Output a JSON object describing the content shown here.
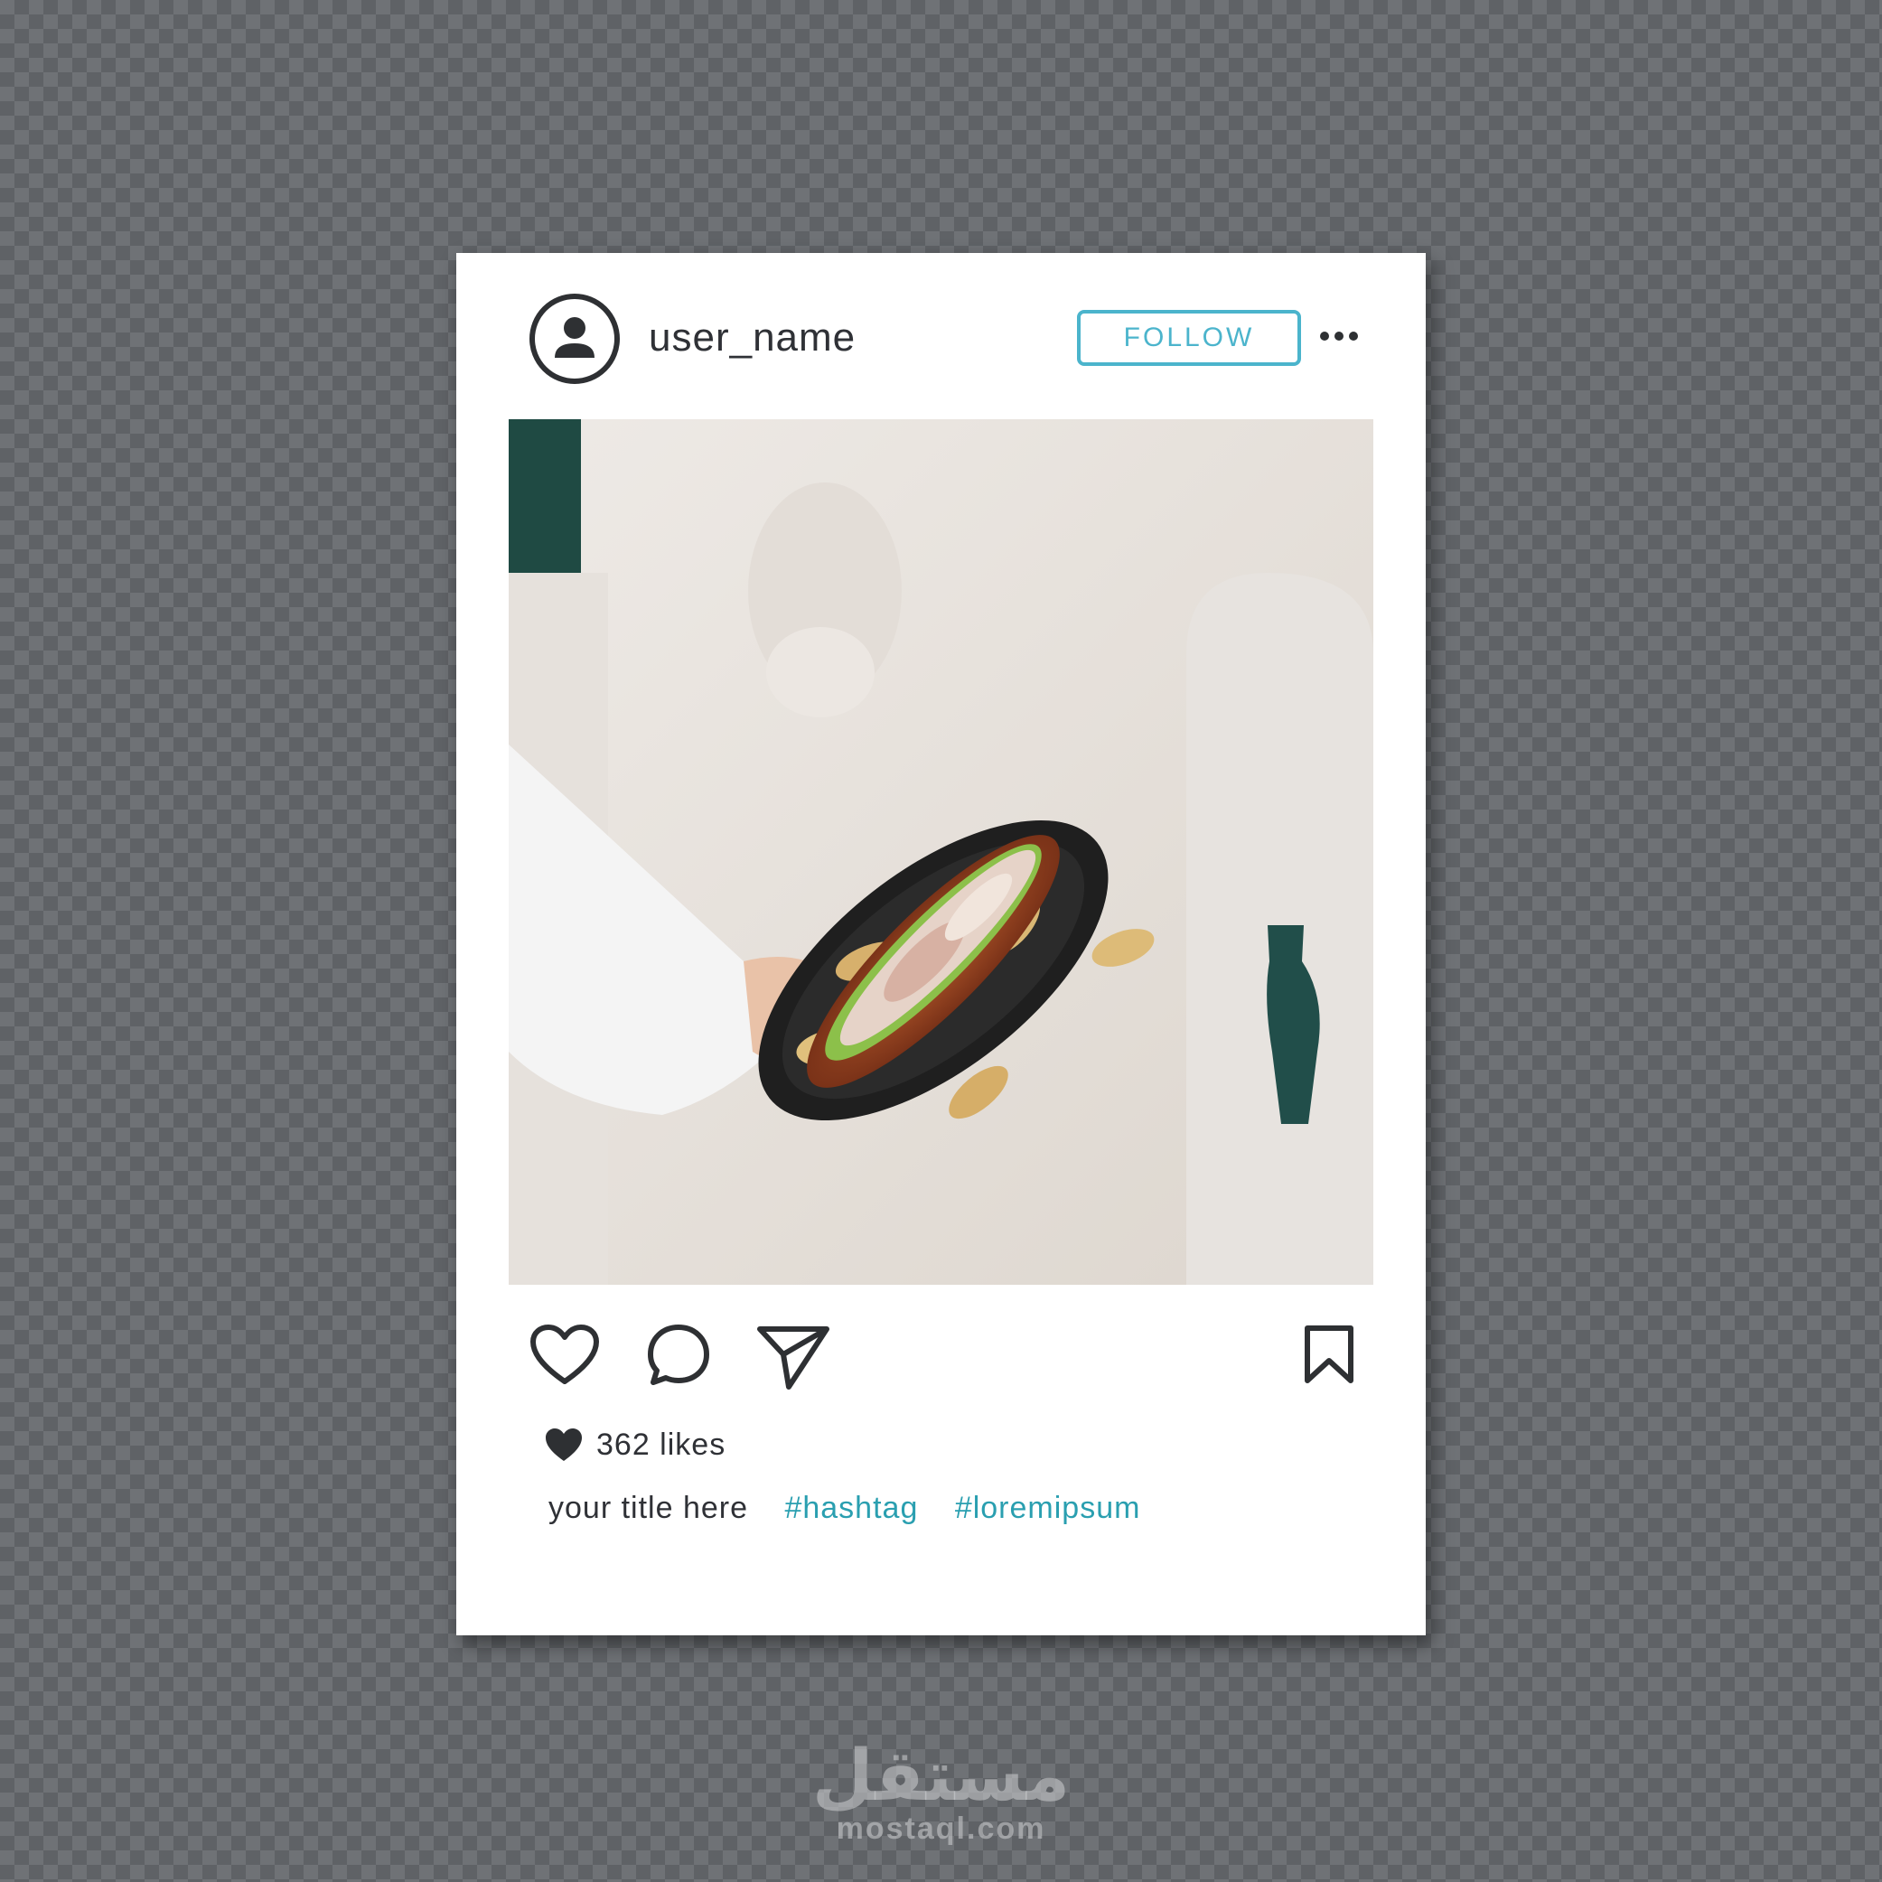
{
  "post": {
    "username": "user_name",
    "follow_label": "FOLLOW",
    "likes_text": "362 likes",
    "caption_title": "your title here",
    "hashtags": [
      "#hashtag",
      "#loremipsum"
    ]
  },
  "icons": {
    "avatar": "user-avatar-icon",
    "more": "more-options-icon",
    "like": "heart-outline-icon",
    "comment": "comment-bubble-icon",
    "share": "paper-plane-icon",
    "save": "bookmark-icon",
    "likes": "heart-filled-icon"
  },
  "colors": {
    "accent": "#4bb4cc",
    "hashtag": "#2a9fb0",
    "text": "#2f3136"
  },
  "watermark": {
    "logo": "مستقل",
    "url": "mostaql.com"
  }
}
